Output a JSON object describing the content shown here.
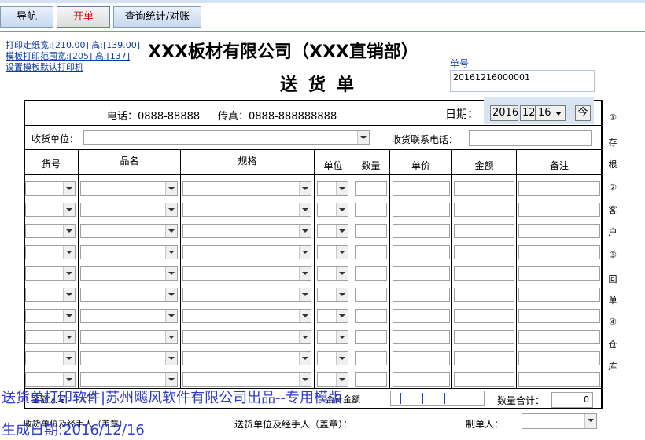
{
  "tabs": [
    {
      "label": "导航"
    },
    {
      "label": "开单"
    },
    {
      "label": "查询统计/对账"
    }
  ],
  "links": [
    "打印走纸宽:[210.00] 高:[139.00]",
    "模板打印范围宽:[205] 高:[137]",
    "设置模板默认打印机"
  ],
  "company_name": "XXX板材有限公司（XXX直销部）",
  "doc_title": "送货单",
  "doc_no_label": "单号",
  "doc_no": "20161216000001",
  "phone": "电话：0888-88888",
  "fax": "传真：0888-888888888",
  "date_label": "日期：",
  "date": {
    "year": "2016",
    "month": "12",
    "day": "16",
    "today_button": "今"
  },
  "receiver_label": "收货单位：",
  "receiver_phone_label": "收货联系电话：",
  "columns": [
    "货号",
    "品名",
    "规格",
    "单位",
    "数量",
    "单价",
    "金额",
    "备注"
  ],
  "side_labels": [
    "①",
    "存",
    "根",
    "②",
    "客",
    "户",
    "③",
    "回",
    "单",
    "④",
    "仓",
    "库"
  ],
  "total_label": "金额大写：",
  "total_amount_label": "合计金额",
  "qty_total_label": "数量合计：",
  "qty_total_value": "0",
  "footer": {
    "receiver_sign": "收货单位及经手人（盖章）",
    "sender_sign": "送货单位及经手人（盖章）：",
    "maker": "制单人："
  },
  "watermark": {
    "line1": "送货单打印软件|苏州飚风软件有限公司出品--专用模版",
    "line2": "生成日期:2016/12/16"
  }
}
